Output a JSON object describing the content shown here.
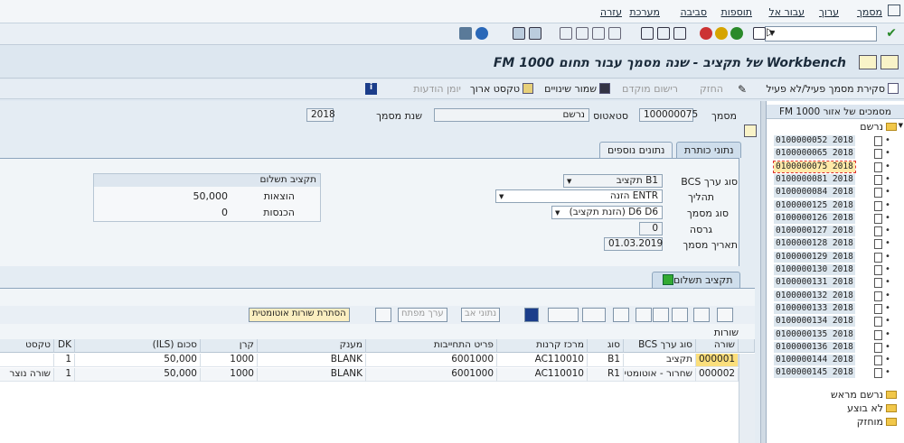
{
  "menu": [
    "מסמך",
    "ערוך",
    "עבור אל",
    "תוספות",
    "סביבה",
    "מערכת",
    "עזרה"
  ],
  "title": "Workbench של תקציב - שנה מסמך עבור תחום FM 1000",
  "apptb": {
    "toggle": "סקירת מסמך פעיל/לא פעיל",
    "hold": "החזק",
    "prepost": "רישום מוקדם",
    "save_changes": "שמור שינויים",
    "long_text": "טקסט ארוך",
    "msg_log": "יומן הודעות"
  },
  "header": {
    "doc_label": "מסמך",
    "doc_value": "100000075",
    "status_label": "סטאטוס",
    "status_value": "נרשם",
    "year_label": "שנת מסמך",
    "year_value": "2018"
  },
  "tabs": {
    "header": "נתוני כותרת",
    "additional": "נתונים נוספים"
  },
  "form": {
    "bcs_label": "סוג ערך BCS",
    "bcs_value": "B1 תקציב",
    "process_label": "תהליך",
    "process_value": "ENTR הזנה",
    "doctype_label": "סוג מסמך",
    "doctype_value": "D6 D6 (הזנת תקציב)",
    "version_label": "גרסה",
    "version_value": "0",
    "date_label": "תאריך מסמך",
    "date_value": "01.03.2019"
  },
  "payment": {
    "title": "תקציב תשלום",
    "exp_label": "הוצאות",
    "exp_value": "50,000",
    "rev_label": "הכנסות",
    "rev_value": "0"
  },
  "paytab": "תקציב תשלום",
  "grid_toolbar": {
    "hide_auto": "הסתרת שורות אוטומטית",
    "key_value": "ערך מפתח",
    "data_in": "נתוני אב"
  },
  "rows_label": "שורות",
  "grid": {
    "cols": [
      "שורה",
      "סוג ערך BCS",
      "סוג",
      "מרכז קרנות",
      "פריט התחייבות",
      "מענק",
      "קרן",
      "סכום (ILS)",
      "DK",
      "טקסט"
    ],
    "rows": [
      [
        "000001",
        "תקציב",
        "B1",
        "AC110010",
        "6001000",
        "BLANK",
        "1000",
        "50,000",
        "1",
        ""
      ],
      [
        "000002",
        "שחרור - אוטומטי",
        "R1",
        "AC110010",
        "6001000",
        "BLANK",
        "1000",
        "50,000",
        "1",
        "שורה נוצר"
      ]
    ]
  },
  "leftpanel": {
    "head": "מסמכים של אזור FM 1000",
    "posted": "נרשם",
    "docs": [
      "0100000052 2018",
      "0100000065 2018",
      "0100000075 2018",
      "0100000081 2018",
      "0100000084 2018",
      "0100000125 2018",
      "0100000126 2018",
      "0100000127 2018",
      "0100000128 2018",
      "0100000129 2018",
      "0100000130 2018",
      "0100000131 2018",
      "0100000132 2018",
      "0100000133 2018",
      "0100000134 2018",
      "0100000135 2018",
      "0100000136 2018",
      "0100000144 2018",
      "0100000145 2018"
    ],
    "preposted": "נרשם מראש",
    "not_done": "לא בוצע",
    "held": "מוחזק"
  }
}
